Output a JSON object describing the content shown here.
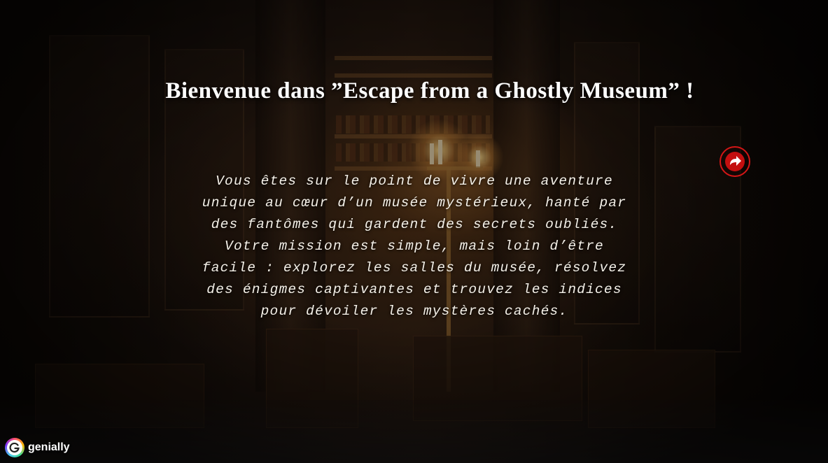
{
  "scene": {
    "background_icon": "haunted-museum-library-background"
  },
  "title": "Bienvenue dans ”Escape from a Ghostly Museum” !",
  "intro_lines": [
    "Vous êtes sur le point de vivre une aventure",
    "unique au cœur d’un musée mystérieux, hanté par",
    "des fantômes qui gardent des secrets oubliés.",
    "Votre mission est simple, mais loin d’être",
    "facile : explorez les salles du musée, résolvez",
    "des énigmes captivantes et trouvez les indices",
    "pour dévoiler les mystères cachés."
  ],
  "next_button": {
    "icon": "arrow-right-circle-icon",
    "color": "#d41616"
  },
  "branding": {
    "icon": "genially-logo-icon",
    "label": "genially"
  },
  "colors": {
    "title_text": "#ffffff",
    "body_text": "#f4f0e8",
    "accent": "#d41616"
  }
}
